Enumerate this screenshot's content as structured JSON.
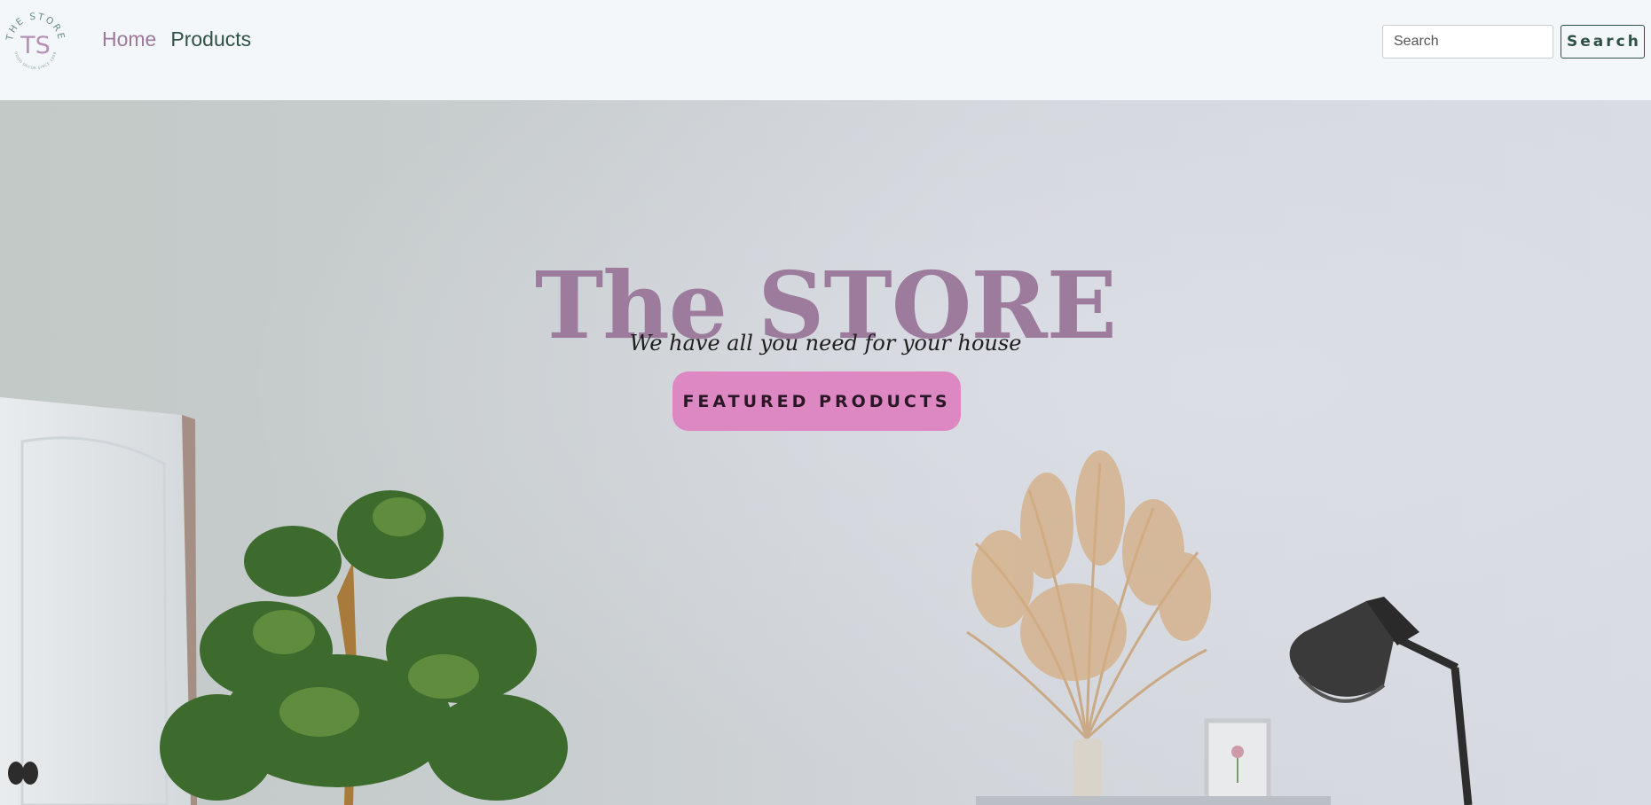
{
  "brand": {
    "logo_ring_text": "THE STORE",
    "logo_initials": "TS",
    "logo_bottom_text": "GOOD DECOR SINCE 1998"
  },
  "nav": {
    "items": [
      {
        "label": "Home",
        "active": true
      },
      {
        "label": "Products",
        "active": false
      }
    ]
  },
  "search": {
    "placeholder": "Search",
    "value": "",
    "button_label": "Search"
  },
  "hero": {
    "title": "The STORE",
    "subtitle": "We have all you need for your house",
    "cta_label": "FEATURED PRODUCTS"
  },
  "colors": {
    "accent_mauve": "#9d7b9c",
    "accent_green": "#2e5246",
    "cta_pink": "#de88c3",
    "navbar_bg": "#f4f7fa"
  }
}
